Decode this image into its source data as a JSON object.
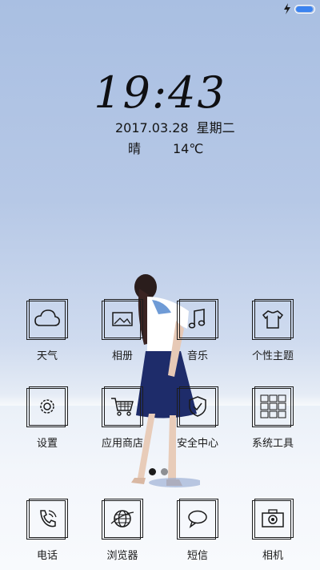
{
  "status": {
    "battery_level": 0.95
  },
  "clock": {
    "time": "19:43"
  },
  "date": {
    "date": "2017.03.28",
    "weekday": "星期二"
  },
  "weather": {
    "condition": "晴",
    "temp": "14℃"
  },
  "apps": {
    "row1": [
      {
        "label": "天气",
        "icon": "cloud-icon"
      },
      {
        "label": "相册",
        "icon": "picture-icon"
      },
      {
        "label": "音乐",
        "icon": "music-note-icon"
      },
      {
        "label": "个性主题",
        "icon": "tshirt-icon"
      }
    ],
    "row2": [
      {
        "label": "设置",
        "icon": "gear-icon"
      },
      {
        "label": "应用商店",
        "icon": "shopping-cart-icon"
      },
      {
        "label": "安全中心",
        "icon": "shield-icon"
      },
      {
        "label": "系统工具",
        "icon": "tools-grid-icon"
      }
    ],
    "dock": [
      {
        "label": "电话",
        "icon": "phone-icon"
      },
      {
        "label": "浏览器",
        "icon": "globe-icon"
      },
      {
        "label": "短信",
        "icon": "chat-bubble-icon"
      },
      {
        "label": "相机",
        "icon": "camera-icon"
      }
    ]
  },
  "pager": {
    "pages": 2,
    "current": 1
  }
}
